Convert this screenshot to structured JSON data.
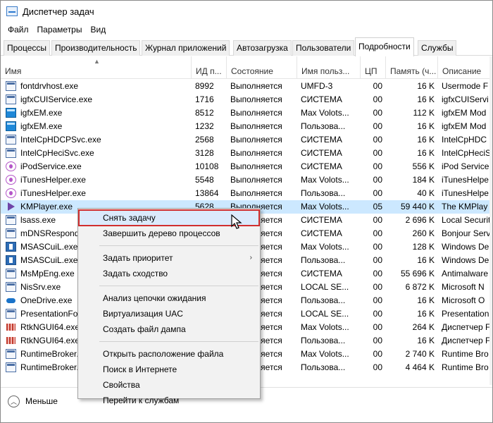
{
  "window": {
    "title": "Диспетчер задач"
  },
  "menu": [
    "Файл",
    "Параметры",
    "Вид"
  ],
  "tabs": [
    "Процессы",
    "Производительность",
    "Журнал приложений",
    "Автозагрузка",
    "Пользователи",
    "Подробности",
    "Службы"
  ],
  "active_tab": "Подробности",
  "columns": [
    "Имя",
    "ИД п...",
    "Состояние",
    "Имя польз...",
    "ЦП",
    "Память (ч...",
    "Описание"
  ],
  "rows": [
    {
      "name": "fontdrvhost.exe",
      "pid": "8992",
      "status": "Выполняется",
      "user": "UMFD-3",
      "cpu": "00",
      "mem": "16 K",
      "desc": "Usermode F",
      "icon": "window-icon"
    },
    {
      "name": "igfxCUIService.exe",
      "pid": "1716",
      "status": "Выполняется",
      "user": "СИСТЕМА",
      "cpu": "00",
      "mem": "16 K",
      "desc": "igfxCUIServi",
      "icon": "window-icon"
    },
    {
      "name": "igfxEM.exe",
      "pid": "8512",
      "status": "Выполняется",
      "user": "Max Volots...",
      "cpu": "00",
      "mem": "112 K",
      "desc": "igfxEM Mod",
      "icon": "intel-icon"
    },
    {
      "name": "igfxEM.exe",
      "pid": "1232",
      "status": "Выполняется",
      "user": "Пользова...",
      "cpu": "00",
      "mem": "16 K",
      "desc": "igfxEM Mod",
      "icon": "intel-icon"
    },
    {
      "name": "IntelCpHDCPSvc.exe",
      "pid": "2568",
      "status": "Выполняется",
      "user": "СИСТЕМА",
      "cpu": "00",
      "mem": "16 K",
      "desc": "IntelCpHDC",
      "icon": "window-icon"
    },
    {
      "name": "IntelCpHeciSvc.exe",
      "pid": "3128",
      "status": "Выполняется",
      "user": "СИСТЕМА",
      "cpu": "00",
      "mem": "16 K",
      "desc": "IntelCpHeciS",
      "icon": "window-icon"
    },
    {
      "name": "iPodService.exe",
      "pid": "10108",
      "status": "Выполняется",
      "user": "СИСТЕМА",
      "cpu": "00",
      "mem": "556 K",
      "desc": "iPod Service",
      "icon": "itunes-icon"
    },
    {
      "name": "iTunesHelper.exe",
      "pid": "5548",
      "status": "Выполняется",
      "user": "Max Volots...",
      "cpu": "00",
      "mem": "184 K",
      "desc": "iTunesHelpe",
      "icon": "itunes-icon"
    },
    {
      "name": "iTunesHelper.exe",
      "pid": "13864",
      "status": "Выполняется",
      "user": "Пользова...",
      "cpu": "00",
      "mem": "40 K",
      "desc": "iTunesHelpe",
      "icon": "itunes-icon"
    },
    {
      "name": "KMPlayer.exe",
      "pid": "5628",
      "status": "Выполняется",
      "user": "Max Volots...",
      "cpu": "05",
      "mem": "59 440 K",
      "desc": "The KMPlay",
      "icon": "play-icon",
      "selected": true
    },
    {
      "name": "lsass.exe",
      "pid": "",
      "status": "Выполняется",
      "user": "СИСТЕМА",
      "cpu": "00",
      "mem": "2 696 K",
      "desc": "Local Securit",
      "icon": "window-icon"
    },
    {
      "name": "mDNSResponde",
      "pid": "",
      "status": "Выполняется",
      "user": "СИСТЕМА",
      "cpu": "00",
      "mem": "260 K",
      "desc": "Bonjour Serv",
      "icon": "window-icon"
    },
    {
      "name": "MSASCuiL.exe",
      "pid": "",
      "status": "Выполняется",
      "user": "Max Volots...",
      "cpu": "00",
      "mem": "128 K",
      "desc": "Windows De",
      "icon": "shield-icon"
    },
    {
      "name": "MSASCuiL.exe",
      "pid": "",
      "status": "Выполняется",
      "user": "Пользова...",
      "cpu": "00",
      "mem": "16 K",
      "desc": "Windows De",
      "icon": "shield-icon"
    },
    {
      "name": "MsMpEng.exe",
      "pid": "",
      "status": "Выполняется",
      "user": "СИСТЕМА",
      "cpu": "00",
      "mem": "55 696 K",
      "desc": "Antimalware",
      "icon": "window-icon"
    },
    {
      "name": "NisSrv.exe",
      "pid": "",
      "status": "Выполняется",
      "user": "LOCAL SE...",
      "cpu": "00",
      "mem": "6 872 K",
      "desc": "Microsoft N",
      "icon": "window-icon"
    },
    {
      "name": "OneDrive.exe",
      "pid": "",
      "status": "Выполняется",
      "user": "Пользова...",
      "cpu": "00",
      "mem": "16 K",
      "desc": "Microsoft O",
      "icon": "cloud-icon"
    },
    {
      "name": "PresentationFon",
      "pid": "",
      "status": "Выполняется",
      "user": "LOCAL SE...",
      "cpu": "00",
      "mem": "16 K",
      "desc": "Presentation",
      "icon": "window-icon"
    },
    {
      "name": "RtkNGUI64.exe",
      "pid": "",
      "status": "Выполняется",
      "user": "Max Volots...",
      "cpu": "00",
      "mem": "264 K",
      "desc": "Диспетчер F",
      "icon": "audio-icon"
    },
    {
      "name": "RtkNGUI64.exe",
      "pid": "",
      "status": "Выполняется",
      "user": "Пользова...",
      "cpu": "00",
      "mem": "16 K",
      "desc": "Диспетчер F",
      "icon": "audio-icon"
    },
    {
      "name": "RuntimeBroker.exe",
      "pid": "",
      "status": "Выполняется",
      "user": "Max Volots...",
      "cpu": "00",
      "mem": "2 740 K",
      "desc": "Runtime Bro",
      "icon": "window-icon"
    },
    {
      "name": "RuntimeBroker.exe",
      "pid": "",
      "status": "Выполняется",
      "user": "Пользова...",
      "cpu": "00",
      "mem": "4 464 K",
      "desc": "Runtime Bro",
      "icon": "window-icon"
    }
  ],
  "context_menu": {
    "items": [
      {
        "label": "Снять задачу",
        "highlighted": true
      },
      {
        "label": "Завершить дерево процессов"
      },
      {
        "separator": true
      },
      {
        "label": "Задать приоритет",
        "submenu": true
      },
      {
        "label": "Задать сходство"
      },
      {
        "separator": true
      },
      {
        "label": "Анализ цепочки ожидания"
      },
      {
        "label": "Виртуализация UAC"
      },
      {
        "label": "Создать файл дампа"
      },
      {
        "separator": true
      },
      {
        "label": "Открыть расположение файла"
      },
      {
        "label": "Поиск в Интернете"
      },
      {
        "label": "Свойства"
      },
      {
        "label": "Перейти к службам"
      }
    ]
  },
  "footer": {
    "fewer_label": "Меньше"
  }
}
